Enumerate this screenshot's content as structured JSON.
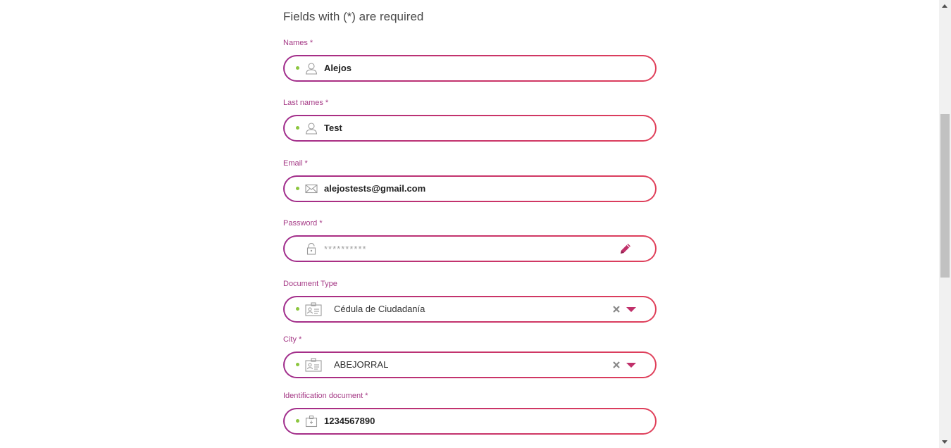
{
  "form": {
    "required_note": "Fields with (*) are required",
    "names": {
      "label": "Names *",
      "value": "Alejos",
      "icon": "user-icon"
    },
    "last_names": {
      "label": "Last names *",
      "value": "Test",
      "icon": "user-icon"
    },
    "email": {
      "label": "Email *",
      "value": "alejostests@gmail.com",
      "icon": "envelope-icon"
    },
    "password": {
      "label": "Password *",
      "placeholder": "**********",
      "icon": "lock-icon",
      "action_icon": "pencil-icon"
    },
    "document_type": {
      "label": "Document Type",
      "value": "Cédula de Ciudadanía",
      "icon": "id-card-icon"
    },
    "city": {
      "label": "City *",
      "value": "ABEJORRAL",
      "icon": "id-card-icon"
    },
    "identification_document": {
      "label": "Identification document *",
      "value": "1234567890",
      "icon": "badge-icon"
    }
  },
  "colors": {
    "label": "#a53a86",
    "border_start": "#a02d8c",
    "border_end": "#e0405a",
    "status_dot": "#8cc63f",
    "accent": "#c93468"
  }
}
